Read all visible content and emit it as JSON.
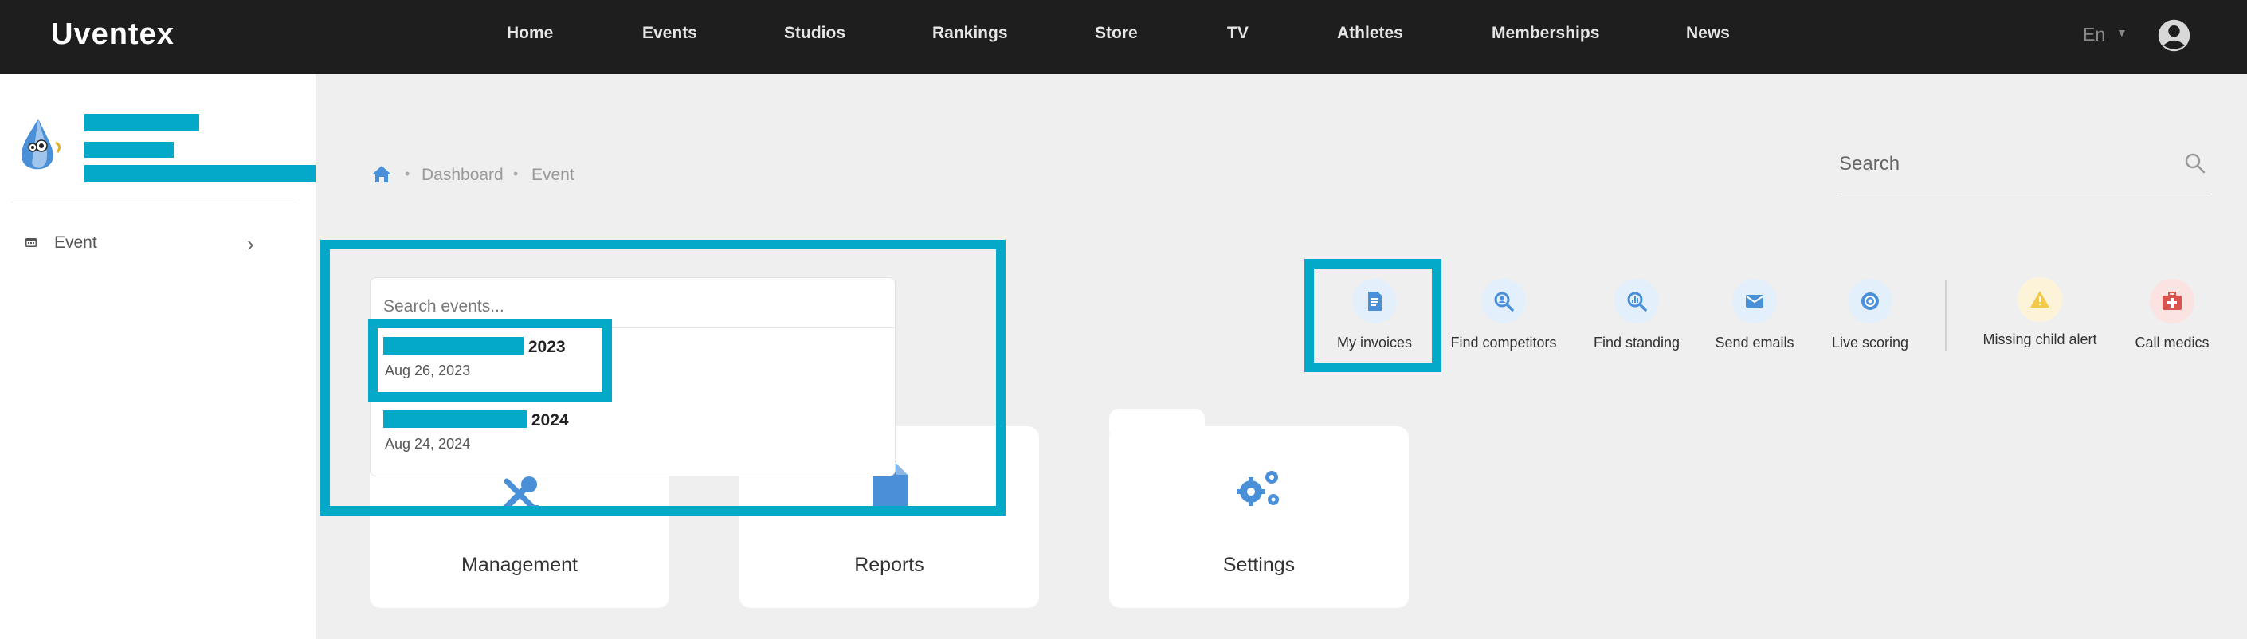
{
  "brand": {
    "logo": "Uventex"
  },
  "nav": {
    "items": [
      "Home",
      "Events",
      "Studios",
      "Rankings",
      "Store",
      "TV",
      "Athletes",
      "Memberships",
      "News"
    ],
    "language": "En"
  },
  "sidebar": {
    "event_label": "Event"
  },
  "breadcrumb": {
    "items": [
      "Dashboard",
      "Event"
    ]
  },
  "search": {
    "placeholder": "Search"
  },
  "dropdown": {
    "placeholder": "Search events...",
    "results": [
      {
        "title_suffix": " 2023",
        "date": "Aug 26, 2023"
      },
      {
        "title_suffix": " 2024",
        "date": "Aug 24, 2024"
      }
    ]
  },
  "quick_actions": {
    "items": [
      {
        "label": "My invoices",
        "icon": "invoice-icon",
        "color": "#4a90d9"
      },
      {
        "label": "Find competitors",
        "icon": "find-competitors-icon",
        "color": "#4a90d9"
      },
      {
        "label": "Find standing",
        "icon": "find-standing-icon",
        "color": "#4a90d9"
      },
      {
        "label": "Send emails",
        "icon": "email-icon",
        "color": "#4a90d9"
      },
      {
        "label": "Live scoring",
        "icon": "live-scoring-icon",
        "color": "#4a90d9"
      },
      {
        "label": "Missing child alert",
        "icon": "warning-icon",
        "color": "#f2c94c"
      },
      {
        "label": "Call medics",
        "icon": "medkit-icon",
        "color": "#d9534f"
      }
    ]
  },
  "cards": [
    {
      "label": "Management",
      "icon": "tools-icon"
    },
    {
      "label": "Reports",
      "icon": "report-icon"
    },
    {
      "label": "Settings",
      "icon": "gears-icon"
    }
  ],
  "colors": {
    "accent": "#04a8c8",
    "topbar": "#1e1e1e",
    "icon_blue": "#4a90d9"
  }
}
